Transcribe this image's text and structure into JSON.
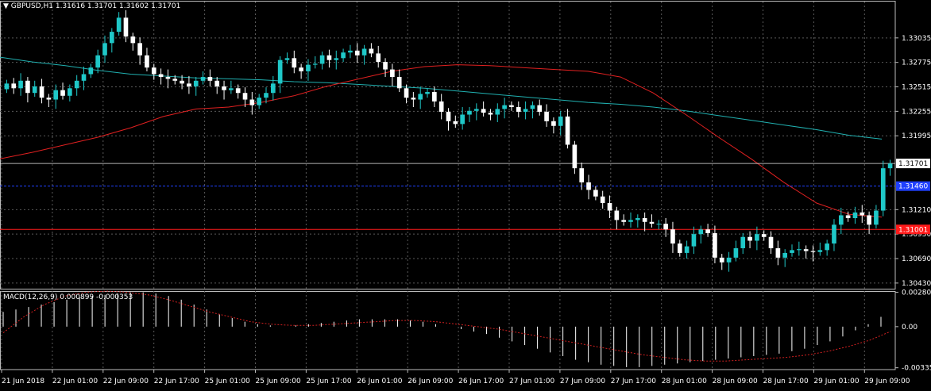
{
  "header": {
    "arrow": "▼",
    "symbol": "GBPUSD,H1",
    "ohlc": "1.31616 1.31701 1.31602 1.31701"
  },
  "macd": {
    "label": "MACD(12,26,9) 0.000899 -0.000353"
  },
  "colors": {
    "background": "#000000",
    "grid": "#5a5a5a",
    "bull": "#1fc8c8",
    "bear": "#ffffff",
    "ma_fast": "#e02020",
    "ma_slow": "#20b0b0",
    "bid_line": "#ffffff",
    "blue_level": "#2040ff",
    "red_level": "#ff1a1a",
    "macd_hist": "#ffffff",
    "macd_signal": "#d02020"
  },
  "chart_data": [
    {
      "type": "candlestick",
      "symbol": "GBPUSD",
      "timeframe": "H1",
      "ylim": [
        1.3037,
        1.3332
      ],
      "y_ticks": [
        "1.33035",
        "1.32775",
        "1.32515",
        "1.32255",
        "1.31995",
        "1.31210",
        "1.30950",
        "1.30690",
        "1.30430"
      ],
      "current_price_label": "1.31701",
      "blue_level": {
        "value": 1.3146,
        "label": "1.31460"
      },
      "red_level": {
        "value": 1.31,
        "label": "1.31001"
      },
      "x_ticks": [
        "21 Jun 2018",
        "22 Jun 01:00",
        "22 Jun 09:00",
        "22 Jun 17:00",
        "25 Jun 01:00",
        "25 Jun 09:00",
        "25 Jun 17:00",
        "26 Jun 01:00",
        "26 Jun 09:00",
        "26 Jun 17:00",
        "27 Jun 01:00",
        "27 Jun 09:00",
        "27 Jun 17:00",
        "28 Jun 01:00",
        "28 Jun 09:00",
        "28 Jun 17:00",
        "29 Jun 01:00",
        "29 Jun 09:00"
      ],
      "price_path": [
        1.3255,
        1.325,
        1.3258,
        1.3245,
        1.3252,
        1.324,
        1.3238,
        1.3248,
        1.3242,
        1.325,
        1.3258,
        1.3265,
        1.3272,
        1.3285,
        1.3298,
        1.331,
        1.3325,
        1.3305,
        1.3298,
        1.3285,
        1.3272,
        1.3265,
        1.3262,
        1.326,
        1.3258,
        1.3255,
        1.3252,
        1.3258,
        1.3262,
        1.3258,
        1.3252,
        1.3248,
        1.325,
        1.3245,
        1.3238,
        1.3232,
        1.324,
        1.3245,
        1.3255,
        1.328,
        1.3282,
        1.3272,
        1.3268,
        1.3275,
        1.3276,
        1.3285,
        1.328,
        1.3282,
        1.3288,
        1.329,
        1.3285,
        1.3292,
        1.3287,
        1.3278,
        1.327,
        1.3262,
        1.325,
        1.324,
        1.3238,
        1.3244,
        1.3246,
        1.3236,
        1.3225,
        1.3215,
        1.3212,
        1.3222,
        1.3226,
        1.3228,
        1.3224,
        1.3222,
        1.3228,
        1.3232,
        1.323,
        1.3225,
        1.3228,
        1.3232,
        1.3225,
        1.3215,
        1.321,
        1.322,
        1.319,
        1.3165,
        1.315,
        1.3142,
        1.3135,
        1.3128,
        1.312,
        1.311,
        1.3108,
        1.311,
        1.3112,
        1.3108,
        1.3106,
        1.3106,
        1.31,
        1.3085,
        1.3075,
        1.3082,
        1.3095,
        1.31,
        1.3096,
        1.307,
        1.3065,
        1.307,
        1.308,
        1.3092,
        1.3088,
        1.3095,
        1.3092,
        1.308,
        1.307,
        1.3075,
        1.3078,
        1.3079,
        1.3077,
        1.3076,
        1.3078,
        1.3085,
        1.3105,
        1.3115,
        1.3112,
        1.3118,
        1.3115,
        1.3105,
        1.312,
        1.3165,
        1.317
      ],
      "ma_fast": [
        1.3175,
        1.3182,
        1.319,
        1.3198,
        1.3208,
        1.322,
        1.3228,
        1.323,
        1.3235,
        1.3242,
        1.3252,
        1.326,
        1.3268,
        1.3273,
        1.3275,
        1.3274,
        1.3272,
        1.327,
        1.3268,
        1.3262,
        1.3245,
        1.3222,
        1.3198,
        1.3175,
        1.315,
        1.3128,
        1.3116,
        1.3113
      ],
      "ma_slow": [
        1.3283,
        1.3278,
        1.3274,
        1.3269,
        1.3265,
        1.3263,
        1.3261,
        1.326,
        1.3259,
        1.3257,
        1.3256,
        1.3254,
        1.3252,
        1.325,
        1.3247,
        1.3244,
        1.3241,
        1.3238,
        1.3235,
        1.3233,
        1.323,
        1.3226,
        1.3221,
        1.3216,
        1.3211,
        1.3206,
        1.32,
        1.3196
      ]
    },
    {
      "type": "macd",
      "params": "12,26,9",
      "main": 0.000899,
      "signal": -0.000353,
      "ylim": [
        -0.0035,
        0.0029
      ],
      "y_ticks": [
        "0.002806",
        "0.00",
        "-0.00335"
      ],
      "hist": [
        0.0012,
        0.0014,
        0.0016,
        0.0018,
        0.002,
        0.0022,
        0.0024,
        0.0025,
        0.0026,
        0.0027,
        0.0028,
        0.0028,
        0.0027,
        0.0025,
        0.0022,
        0.0018,
        0.0014,
        0.001,
        0.0007,
        0.0004,
        0.0002,
        0.0001,
        0.0,
        0.0001,
        0.0002,
        0.0003,
        0.0004,
        0.0005,
        0.0006,
        0.0006,
        0.0006,
        0.0006,
        0.0005,
        0.0004,
        0.0002,
        0.0,
        -0.0002,
        -0.0004,
        -0.0006,
        -0.0009,
        -0.0012,
        -0.0015,
        -0.0018,
        -0.0021,
        -0.0024,
        -0.0027,
        -0.0029,
        -0.0031,
        -0.0032,
        -0.0033,
        -0.0033,
        -0.0032,
        -0.0031,
        -0.003,
        -0.0029,
        -0.0028,
        -0.0027,
        -0.0026,
        -0.0025,
        -0.0024,
        -0.0023,
        -0.0022,
        -0.002,
        -0.0018,
        -0.0015,
        -0.0012,
        -0.0008,
        -0.0003,
        0.0002,
        0.0008
      ],
      "signal_path": [
        -0.0005,
        0.0008,
        0.0018,
        0.0025,
        0.0028,
        0.0029,
        0.0028,
        0.0026,
        0.0022,
        0.0017,
        0.0012,
        0.0008,
        0.0004,
        0.0002,
        0.0001,
        0.0001,
        0.0002,
        0.0003,
        0.0004,
        0.0005,
        0.0005,
        0.0004,
        0.0002,
        0.0,
        -0.0002,
        -0.0005,
        -0.0008,
        -0.0011,
        -0.0014,
        -0.0017,
        -0.002,
        -0.0023,
        -0.0025,
        -0.0027,
        -0.0028,
        -0.0028,
        -0.0027,
        -0.0026,
        -0.0025,
        -0.0023,
        -0.002,
        -0.0016,
        -0.0011,
        -0.0004
      ]
    }
  ]
}
